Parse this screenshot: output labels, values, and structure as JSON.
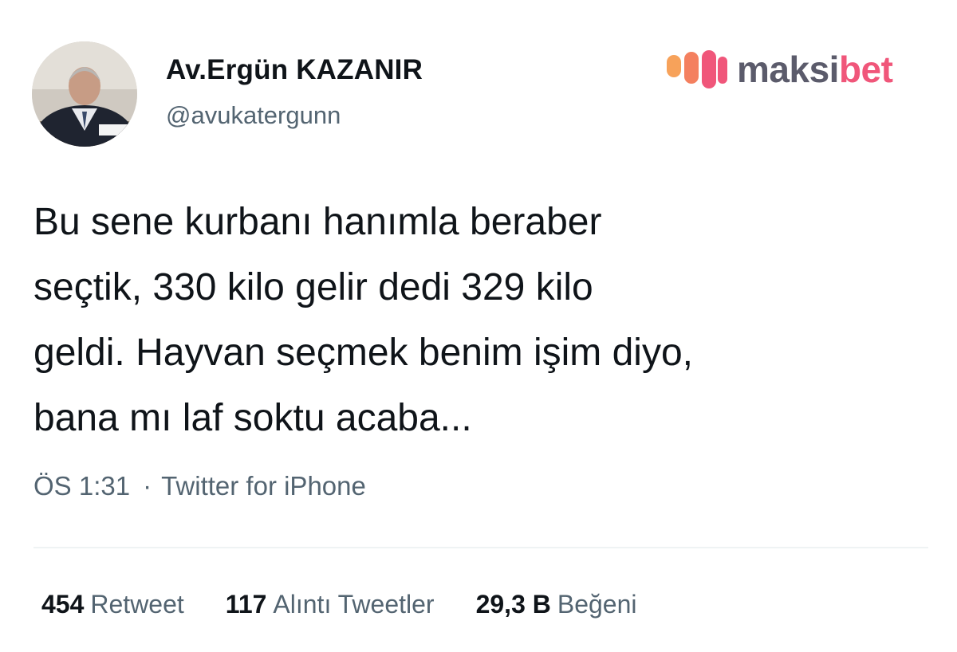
{
  "author": {
    "name": "Av.Ergün KAZANIR",
    "handle": "@avukatergunn",
    "avatar_icon": "profile-photo"
  },
  "watermark": {
    "brand_prefix": "maksi",
    "brand_suffix": "bet",
    "brand_color": "#f0567a",
    "text_color": "#5b5b6b"
  },
  "tweet": {
    "lines": [
      "Bu sene kurbanı hanımla beraber",
      "seçtik, 330 kilo gelir dedi 329 kilo",
      "geldi. Hayvan seçmek benim işim diyo,",
      "bana mı laf soktu acaba..."
    ],
    "time": "ÖS 1:31",
    "separator": "·",
    "source": "Twitter for iPhone"
  },
  "stats": [
    {
      "count": "454",
      "label": "Retweet"
    },
    {
      "count": "117",
      "label": "Alıntı Tweetler"
    },
    {
      "count": "29,3 B",
      "label": "Beğeni"
    }
  ]
}
